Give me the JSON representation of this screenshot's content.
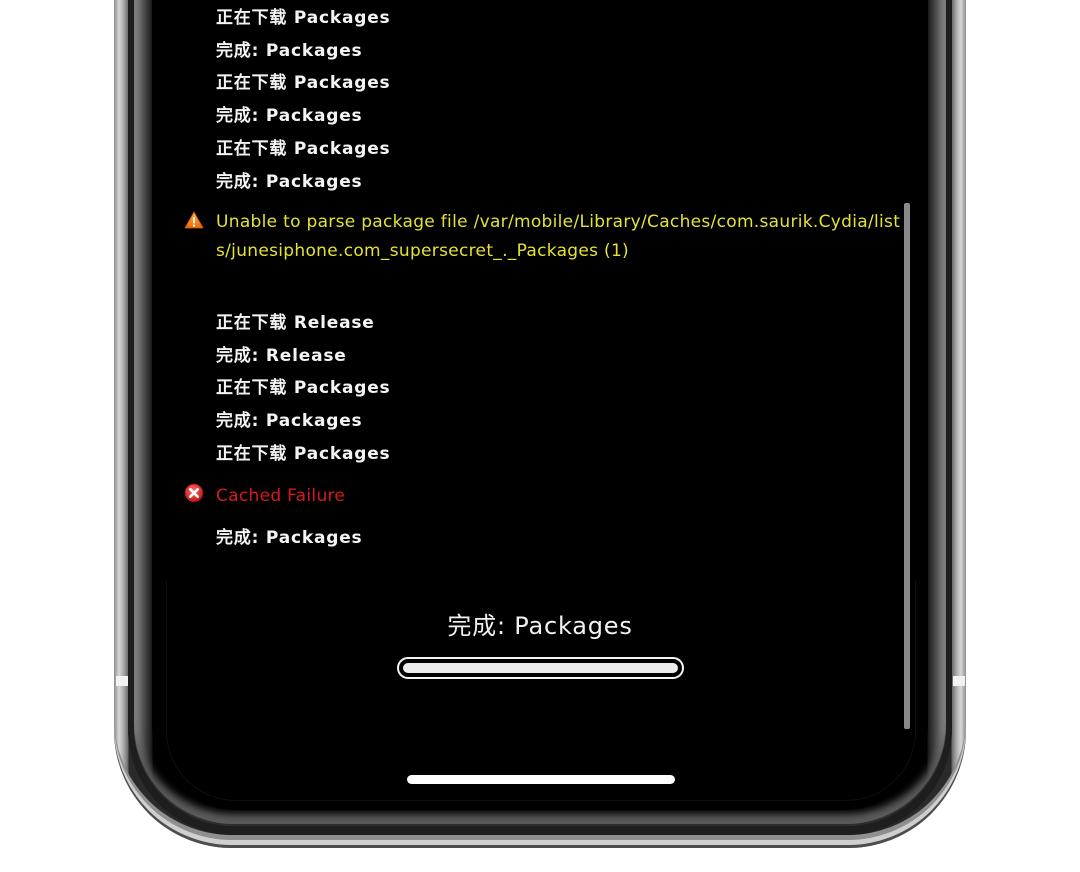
{
  "log": {
    "lines_top": [
      "正在下载 Packages",
      "完成: Packages",
      "正在下载 Packages",
      "完成: Packages",
      "正在下载 Packages",
      "完成: Packages"
    ],
    "warning": {
      "icon": "warning-triangle-icon",
      "text": "Unable to parse package file /var/mobile/Library/Caches/com.saurik.Cydia/lists/junesiphone.com_supersecret_._Packages (1)",
      "color": "#e5e234"
    },
    "lines_middle": [
      "正在下载 Release",
      "完成: Release",
      "正在下载 Packages",
      "完成: Packages",
      "正在下载 Packages"
    ],
    "error": {
      "icon": "error-x-circle-icon",
      "text": "Cached Failure",
      "color": "#d61a1a"
    },
    "lines_bottom": [
      "完成: Packages"
    ]
  },
  "status": {
    "text": "完成: Packages",
    "progress_percent": 100
  }
}
